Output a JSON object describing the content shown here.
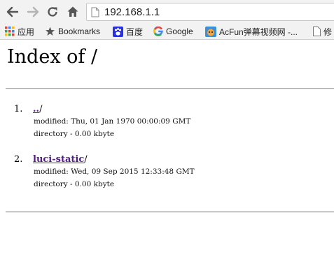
{
  "browser": {
    "url": "192.168.1.1",
    "icons": {
      "back": "back-arrow-icon",
      "forward": "forward-arrow-icon",
      "reload": "reload-icon",
      "home": "home-icon",
      "page": "page-icon"
    }
  },
  "bookmarks_bar": {
    "items": [
      {
        "label": "应用",
        "icon": "apps-grid-icon"
      },
      {
        "label": "Bookmarks",
        "icon": "star-icon"
      },
      {
        "label": "百度",
        "icon": "baidu-paw-icon"
      },
      {
        "label": "Google",
        "icon": "google-g-icon"
      },
      {
        "label": "AcFun弹幕视频网 -...",
        "icon": "acfun-icon"
      },
      {
        "label": "修",
        "icon": "page-icon"
      }
    ]
  },
  "page": {
    "title": "Index of /",
    "entries": [
      {
        "number": "1.",
        "name": "..",
        "suffix": "/",
        "modified": "modified: Thu, 01 Jan 1970 00:00:09 GMT",
        "size": "directory - 0.00 kbyte"
      },
      {
        "number": "2.",
        "name": "luci-static",
        "suffix": "/",
        "modified": "modified: Wed, 09 Sep 2015 12:33:48 GMT",
        "size": "directory - 0.00 kbyte"
      }
    ]
  },
  "colors": {
    "chrome_bg": "#f2f2f2",
    "link_visited": "#551a8b",
    "rule": "#a8a8a8"
  }
}
